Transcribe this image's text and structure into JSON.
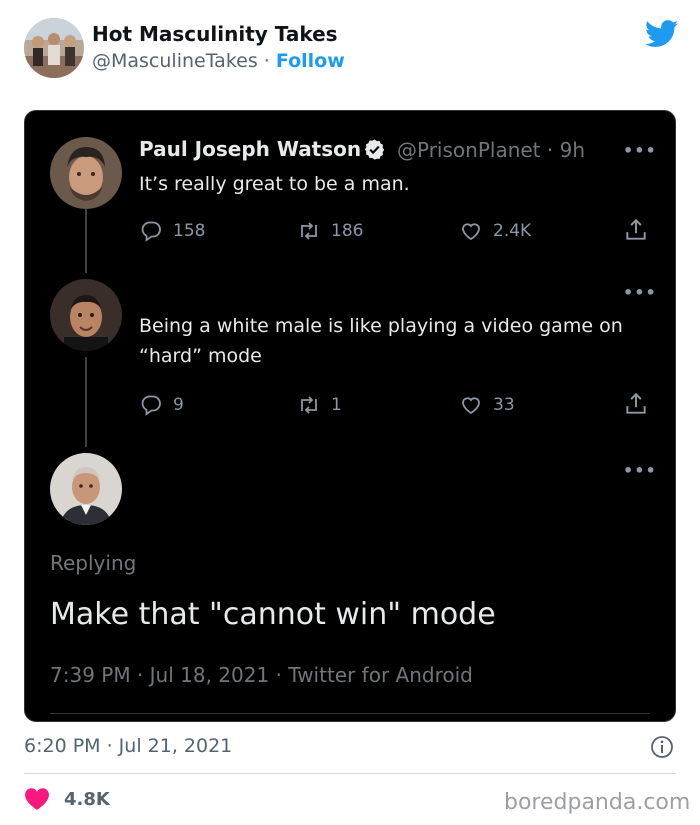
{
  "account": {
    "name": "Hot Masculinity Takes",
    "handle": "@MasculineTakes",
    "separator": "·",
    "follow_label": "Follow"
  },
  "card": {
    "tweets": [
      {
        "name": "Paul Joseph Watson",
        "handle": "@PrisonPlanet · 9h",
        "text": "It’s really great to be a man.",
        "replies": "158",
        "retweets": "186",
        "likes": "2.4K",
        "more": "•••"
      },
      {
        "text": "Being a white male is like playing a video game on “hard” mode",
        "replies": "9",
        "retweets": "1",
        "likes": "33",
        "more": "•••"
      },
      {
        "more": "•••"
      }
    ],
    "replying_label": "Replying",
    "main_text": "Make that \"cannot win\" mode",
    "meta": "7:39 PM · Jul 18, 2021 · Twitter for Android"
  },
  "footer": {
    "timestamp": "6:20 PM · Jul 21, 2021",
    "likes": "4.8K"
  },
  "watermark": "boredpanda.com",
  "icons": {
    "brand": "twitter-bird-icon",
    "verified": "verified-badge-icon",
    "reply": "reply-icon",
    "retweet": "retweet-icon",
    "like": "heart-icon",
    "share": "share-icon",
    "info": "info-icon",
    "footer_like": "heart-filled-icon"
  },
  "colors": {
    "twitter_blue": "#1d9bf0",
    "heart_pink": "#f91880",
    "card_bg": "#000000"
  }
}
